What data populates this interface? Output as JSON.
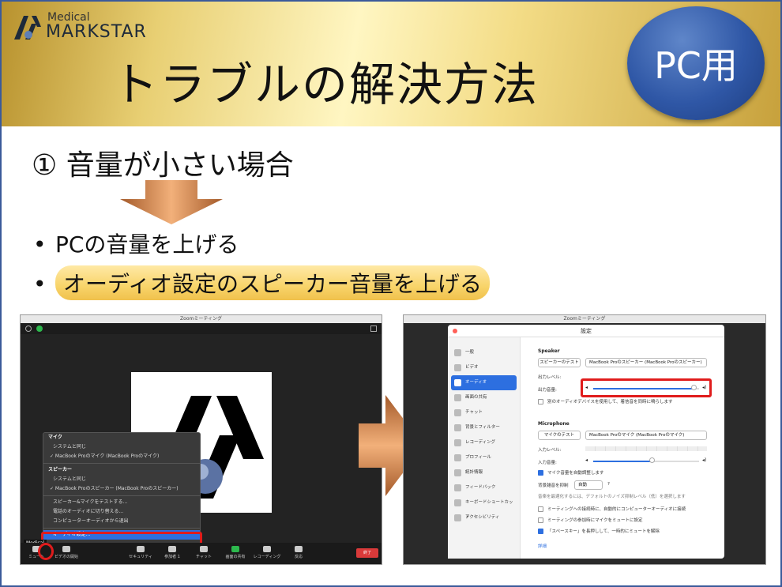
{
  "header": {
    "logo_small": "Medical",
    "logo_name": "MARKSTAR",
    "title": "トラブルの解決方法",
    "badge": "PC用"
  },
  "content": {
    "subtitle": "① 音量が小さい場合",
    "bullets": [
      {
        "dot": "•",
        "text": "PCの音量を上げる"
      },
      {
        "dot": "•",
        "text": "オーディオ設定のスピーカー音量を上げる"
      }
    ]
  },
  "left_screen": {
    "window_title": "Zoomミーティング",
    "participant_name": "Medical",
    "menu": {
      "mic_header": "マイク",
      "mic_same": "システムと同じ",
      "mic_device": "✓ MacBook Proのマイク (MacBook Proのマイク)",
      "speaker_header": "スピーカー",
      "speaker_same": "システムと同じ",
      "speaker_device": "✓ MacBook Proのスピーカー (MacBook Proのスピーカー)",
      "test": "スピーカー&マイクをテストする...",
      "phone": "電話のオーディオに切り替える...",
      "leave": "コンピューターオーディオから退出",
      "settings": "オーディオ設定..."
    },
    "toolbar": {
      "mute": "ミュート",
      "video": "ビデオの開始",
      "security": "セキュリティ",
      "participants": "参加者",
      "participants_count": "1",
      "chat": "チャット",
      "share": "画面の共有",
      "record": "レコーディング",
      "reactions": "反応",
      "end": "終了"
    }
  },
  "right_screen": {
    "window_title": "Zoomミーティング",
    "settings_title": "設定",
    "sidebar": [
      "一般",
      "ビデオ",
      "オーディオ",
      "画面の共有",
      "チャット",
      "背景とフィルター",
      "レコーディング",
      "プロフィール",
      "統計情報",
      "フィードバック",
      "キーボードショートカット",
      "アクセシビリティ"
    ],
    "active_index": 2,
    "speaker": {
      "heading": "Speaker",
      "test_button": "スピーカーのテスト",
      "device": "MacBook Proのスピーカー (MacBook Proのスピーカー)",
      "output_level": "出力レベル:",
      "output_volume": "出力音量:",
      "volume_fraction": 0.95,
      "separate": "別のオーディオデバイスを使用して、着信音を同時に鳴らします"
    },
    "microphone": {
      "heading": "Microphone",
      "test_button": "マイクのテスト",
      "device": "MacBook Proのマイク (MacBook Proのマイク)",
      "input_level": "入力レベル:",
      "input_volume": "入力音量:",
      "volume_fraction": 0.55,
      "auto_adjust": "マイク音量を自動調整します",
      "suppress_label": "背景雑音を抑制",
      "suppress_value": "自動",
      "suppress_help": "?",
      "suppress_note": "音楽を最適化するには、デフォルトのノイズ抑制レベル（低）を選択します"
    },
    "options": {
      "opt1": "ミーティングへの接続時に、自動的にコンピューターオーディオに接続",
      "opt2": "ミーティングの参加時にマイクをミュートに設定",
      "opt3": "「スペースキー」を長押しして、一時的にミュートを解除"
    },
    "details_link": "詳細"
  }
}
